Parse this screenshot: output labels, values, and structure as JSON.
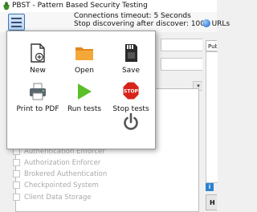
{
  "titlebar": {
    "title": "PBST - Pattern Based Security Testing"
  },
  "status": {
    "line1": "Connections timeout: 5 Seconds",
    "line2": "Stop discovering after discover: 1000 URLs"
  },
  "right_panel": {
    "tab_label": "Public URI",
    "bottom_button_label": "H",
    "info_label": "i"
  },
  "combo": {
    "arrow_glyph": "▾"
  },
  "list": {
    "items": [
      "Authentication Enforcer",
      "Authorization Enforcer",
      "Brokered Authentication",
      "Checkpointed System",
      "Client Data Storage"
    ]
  },
  "menu": {
    "items": [
      {
        "label": "New",
        "icon": "new-document-icon"
      },
      {
        "label": "Open",
        "icon": "folder-icon"
      },
      {
        "label": "Save",
        "icon": "sd-card-icon"
      },
      {
        "label": "Print to PDF",
        "icon": "printer-icon"
      },
      {
        "label": "Run tests",
        "icon": "play-icon"
      },
      {
        "label": "Stop tests",
        "icon": "stop-sign-icon"
      },
      {
        "label": "",
        "icon": "power-icon"
      }
    ],
    "stop_sign_text": "STOP"
  },
  "colors": {
    "accent": "#3c76b8",
    "folder": "#f0a030",
    "play": "#5bbf2a",
    "stop": "#d8231b",
    "power": "#555555"
  }
}
